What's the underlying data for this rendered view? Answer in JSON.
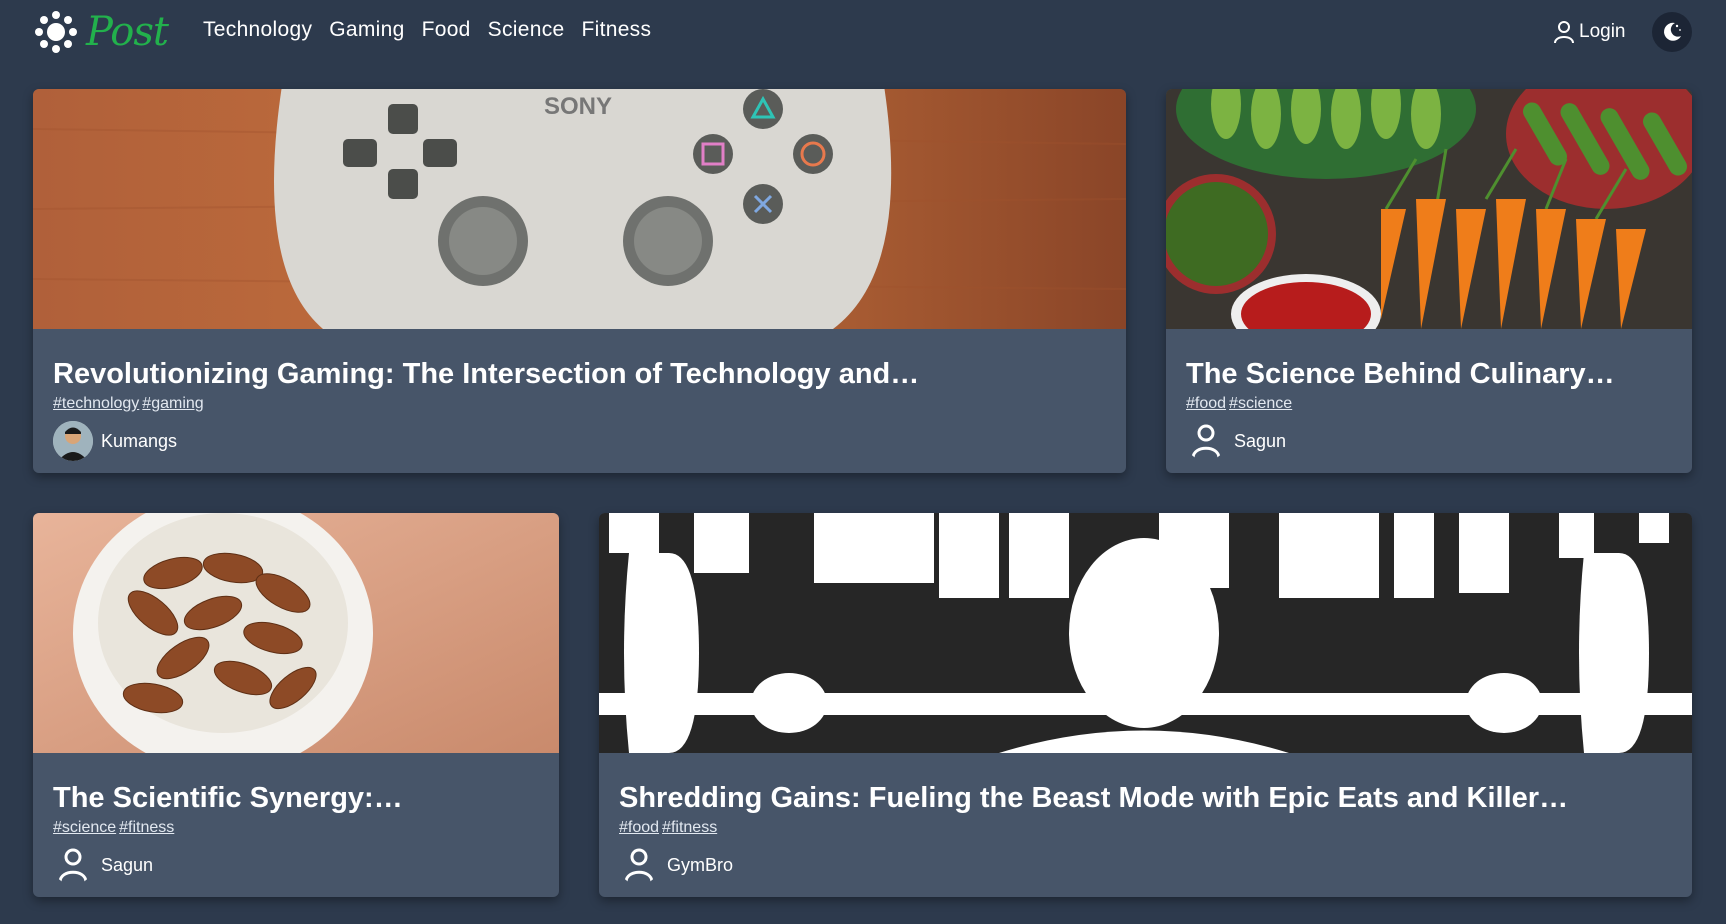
{
  "brand": {
    "name": "Post",
    "color": "#22b14c"
  },
  "nav": {
    "items": [
      "Technology",
      "Gaming",
      "Food",
      "Science",
      "Fitness"
    ]
  },
  "auth": {
    "login_label": "Login"
  },
  "theme": {
    "toggle_icon": "moon-icon"
  },
  "posts": [
    {
      "title": "Revolutionizing Gaming: The Intersection of Technology and…",
      "tags": [
        "#technology",
        "#gaming"
      ],
      "author": "Kumangs",
      "image": "game-controller"
    },
    {
      "title": "The Science Behind Culinary…",
      "tags": [
        "#food",
        "#science"
      ],
      "author": "Sagun",
      "image": "vegetables"
    },
    {
      "title": "The Scientific Synergy:…",
      "tags": [
        "#science",
        "#fitness"
      ],
      "author": "Sagun",
      "image": "almonds-bowl"
    },
    {
      "title": "Shredding Gains: Fueling the Beast Mode with Epic Eats and Killer…",
      "tags": [
        "#food",
        "#fitness"
      ],
      "author": "GymBro",
      "image": "weightlifter"
    }
  ]
}
